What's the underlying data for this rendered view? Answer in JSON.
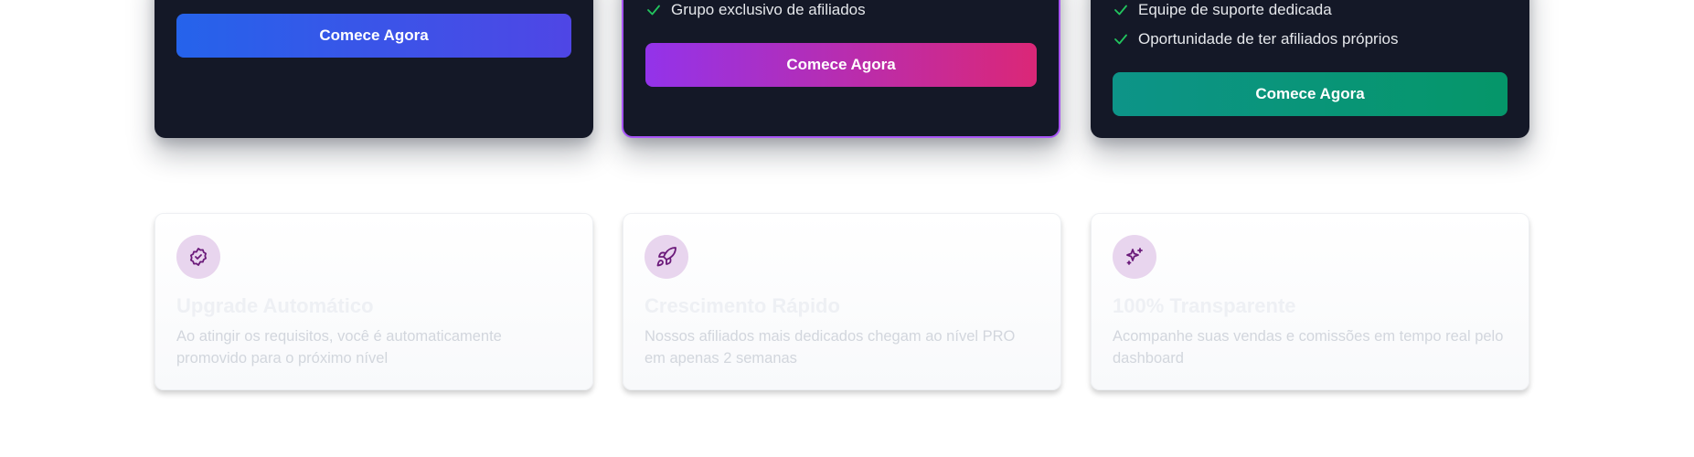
{
  "colors": {
    "card_dark": "#141827",
    "featured_border": "#a855f7",
    "check_green": "#22c55e",
    "icon_purple": "#6b1a7a",
    "icon_bg": "#e8d5ee"
  },
  "plans": [
    {
      "features": [],
      "cta_label": "Comece Agora"
    },
    {
      "features": [
        "Grupo exclusivo de afiliados"
      ],
      "cta_label": "Comece Agora"
    },
    {
      "features": [
        "Equipe de suporte dedicada",
        "Oportunidade de ter afiliados próprios"
      ],
      "cta_label": "Comece Agora"
    }
  ],
  "benefits": [
    {
      "icon": "badge-check-icon",
      "title": "Upgrade Automático",
      "description": "Ao atingir os requisitos, você é automaticamente promovido para o próximo nível"
    },
    {
      "icon": "rocket-icon",
      "title": "Crescimento Rápido",
      "description": "Nossos afiliados mais dedicados chegam ao nível PRO em apenas 2 semanas"
    },
    {
      "icon": "sparkles-icon",
      "title": "100% Transparente",
      "description": "Acompanhe suas vendas e comissões em tempo real pelo dashboard"
    }
  ]
}
